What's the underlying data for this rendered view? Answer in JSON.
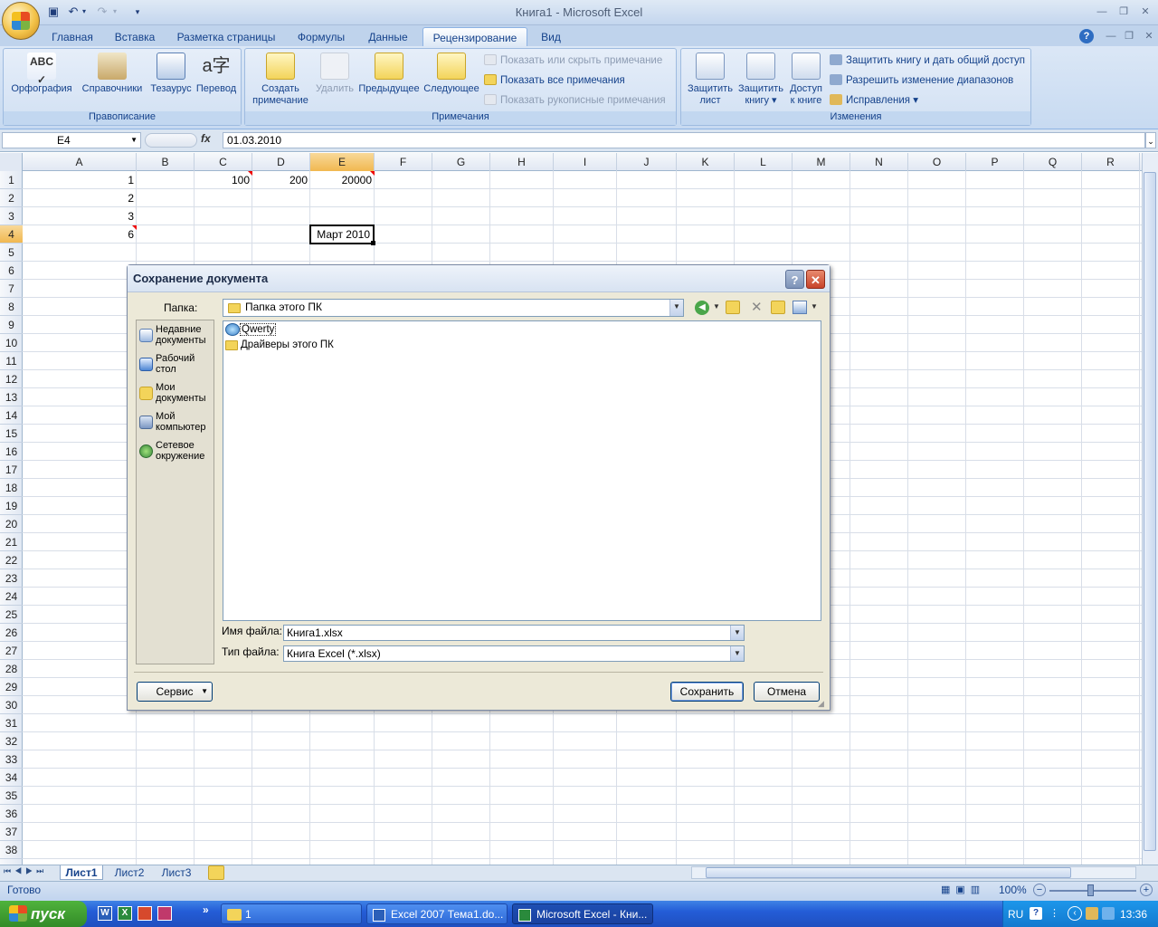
{
  "window": {
    "title": "Книга1 - Microsoft Excel"
  },
  "ribbon": {
    "tabs": [
      "Главная",
      "Вставка",
      "Разметка страницы",
      "Формулы",
      "Данные",
      "Рецензирование",
      "Вид"
    ],
    "active_tab": "Рецензирование",
    "groups": {
      "proofing": {
        "label": "Правописание",
        "spelling": "Орфография",
        "research": "Справочники",
        "thesaurus": "Тезаурус",
        "translate": "Перевод"
      },
      "comments": {
        "label": "Примечания",
        "create_line1": "Создать",
        "create_line2": "примечание",
        "delete": "Удалить",
        "previous": "Предыдущее",
        "next": "Следующее",
        "show_hide": "Показать или скрыть примечание",
        "show_all": "Показать все примечания",
        "show_ink": "Показать рукописные примечания"
      },
      "changes": {
        "label": "Изменения",
        "protect_sheet_1": "Защитить",
        "protect_sheet_2": "лист",
        "protect_book_1": "Защитить",
        "protect_book_2": "книгу",
        "share_1": "Доступ",
        "share_2": "к книге",
        "protect_share": "Защитить книгу и дать общий доступ",
        "allow_ranges": "Разрешить изменение диапазонов",
        "track": "Исправления"
      }
    }
  },
  "formula_bar": {
    "name_box": "E4",
    "fx": "fx",
    "formula": "01.03.2010"
  },
  "grid": {
    "columns": [
      "A",
      "B",
      "C",
      "D",
      "E",
      "F",
      "G",
      "H",
      "I",
      "J",
      "K",
      "L",
      "M",
      "N",
      "O",
      "P",
      "Q",
      "R"
    ],
    "selected_column": "E",
    "rows": [
      "1",
      "2",
      "3",
      "4",
      "5",
      "6",
      "7",
      "8",
      "9",
      "10",
      "11",
      "12",
      "13",
      "14",
      "15",
      "16",
      "17",
      "18",
      "19",
      "20",
      "21",
      "22",
      "23",
      "24",
      "25",
      "26",
      "27",
      "28",
      "29",
      "30",
      "31",
      "32",
      "33",
      "34",
      "35",
      "36",
      "37",
      "38"
    ],
    "selected_row": "4",
    "cells": {
      "A1": "1",
      "A2": "2",
      "A3": "3",
      "A4": "6",
      "C1": "100",
      "D1": "200",
      "E1": "20000",
      "E4": "Март 2010"
    }
  },
  "sheets": {
    "tabs": [
      "Лист1",
      "Лист2",
      "Лист3"
    ],
    "active": "Лист1"
  },
  "status": {
    "text": "Готово",
    "zoom": "100%"
  },
  "dialog": {
    "title": "Сохранение документа",
    "folder_label": "Папка:",
    "folder_value": "Папка этого ПК",
    "places": [
      {
        "line1": "Недавние",
        "line2": "документы"
      },
      {
        "line1": "Рабочий",
        "line2": "стол"
      },
      {
        "line1": "Мои",
        "line2": "документы"
      },
      {
        "line1": "Мой",
        "line2": "компьютер"
      },
      {
        "line1": "Сетевое",
        "line2": "окружение"
      }
    ],
    "files": [
      "Qwerty",
      "Драйверы этого ПК"
    ],
    "filename_label": "Имя файла:",
    "filename_value": "Книга1.xlsx",
    "filetype_label": "Тип файла:",
    "filetype_value": "Книга Excel (*.xlsx)",
    "tools_button": "Сервис",
    "save_button": "Сохранить",
    "cancel_button": "Отмена"
  },
  "taskbar": {
    "start": "пуск",
    "tasks": [
      "1",
      "Excel 2007 Тема1.do...",
      "Microsoft Excel - Кни..."
    ],
    "lang": "RU",
    "clock": "13:36"
  },
  "colors": {
    "accent": "#15428b",
    "selected_header": "#f1b850",
    "comment_marker": "#e00000"
  }
}
